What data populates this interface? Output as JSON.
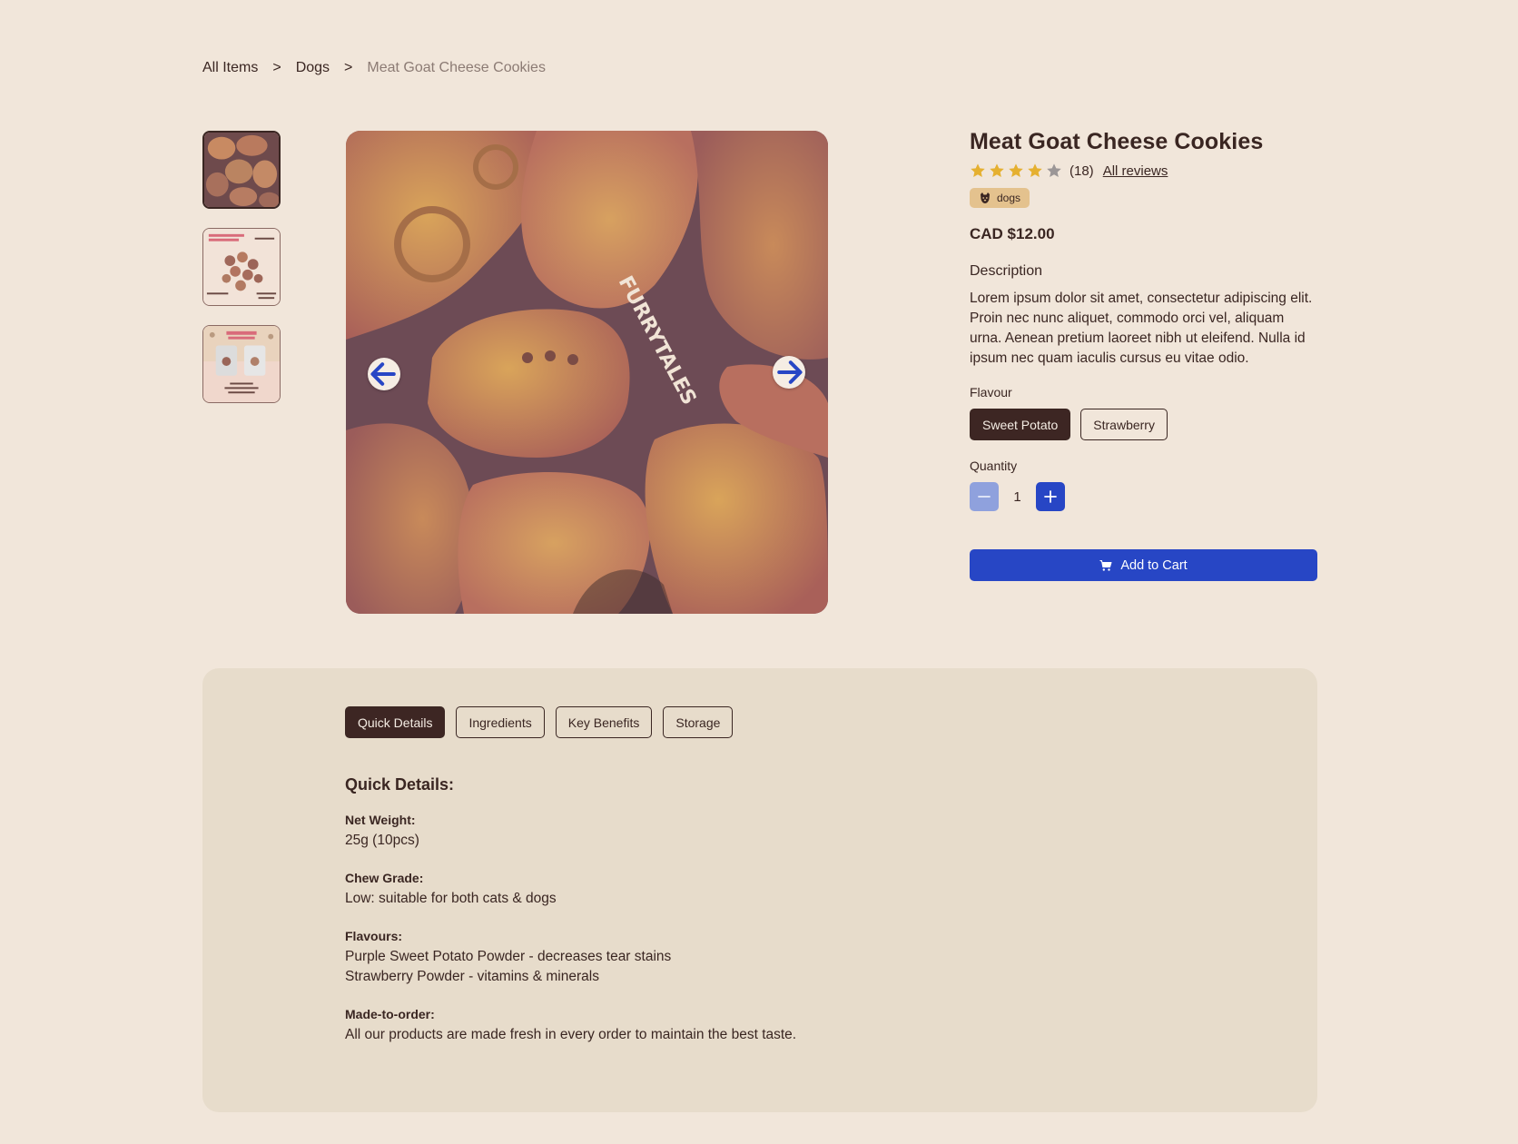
{
  "breadcrumb": {
    "items": [
      "All Items",
      "Dogs",
      "Meat Goat Cheese Cookies"
    ],
    "separator": ">"
  },
  "product": {
    "title": "Meat Goat Cheese Cookies",
    "rating": 4,
    "rating_max": 5,
    "review_count": "(18)",
    "all_reviews_label": "All reviews",
    "tag": "dogs",
    "price": "CAD $12.00",
    "description_label": "Description",
    "description": "Lorem ipsum dolor sit amet, consectetur adipiscing elit. Proin nec nunc aliquet, commodo orci vel, aliquam urna. Aenean pretium laoreet nibh ut eleifend. Nulla id ipsum nec quam iaculis cursus eu vitae odio.",
    "image_text": "FURRYTALES"
  },
  "flavour": {
    "label": "Flavour",
    "options": [
      "Sweet Potato",
      "Strawberry"
    ],
    "selected": "Sweet Potato"
  },
  "quantity": {
    "label": "Quantity",
    "value": "1"
  },
  "cart": {
    "label": "Add to Cart"
  },
  "tabs": [
    "Quick Details",
    "Ingredients",
    "Key Benefits",
    "Storage"
  ],
  "details": {
    "heading": "Quick Details:",
    "net_weight_label": "Net Weight:",
    "net_weight_value": "25g (10pcs)",
    "chew_grade_label": "Chew Grade:",
    "chew_grade_value": "Low: suitable for both cats & dogs",
    "flavours_label": "Flavours:",
    "flavours_line1": "Purple Sweet Potato Powder - decreases tear stains",
    "flavours_line2": "Strawberry Powder - vitamins & minerals",
    "made_label": "Made-to-order:",
    "made_value": "All our products are made fresh in every order to maintain the best taste."
  },
  "colors": {
    "background": "#f1e6da",
    "panel": "#e7dccb",
    "dark": "#3d2623",
    "accent_blue": "#2746c5",
    "light_blue": "#8fa1dd",
    "star": "#e5b030",
    "tag": "#e4c28e"
  },
  "icons": {
    "prev": "arrow-left-icon",
    "next": "arrow-right-icon",
    "cart": "cart-icon",
    "tag": "dog-face-icon",
    "minus": "minus-icon",
    "plus": "plus-icon",
    "star": "star-icon"
  }
}
